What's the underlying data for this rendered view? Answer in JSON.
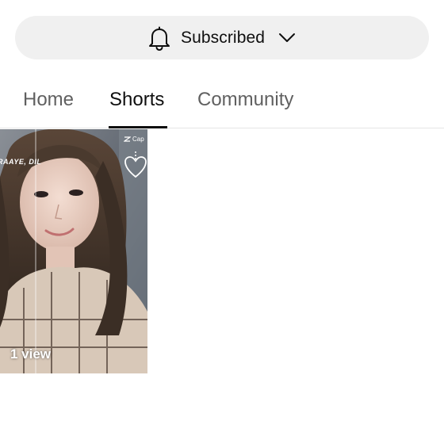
{
  "subscribe": {
    "label": "Subscribed",
    "bell_icon": "bell-icon",
    "chevron_icon": "chevron-down-icon"
  },
  "tabs": [
    {
      "label": "Home",
      "active": false
    },
    {
      "label": "Shorts",
      "active": true
    },
    {
      "label": "Community",
      "active": false
    }
  ],
  "shorts": [
    {
      "overlay_text": "RAAYE, DIL",
      "watermark": "Cap",
      "views": "1 view"
    }
  ],
  "colors": {
    "pill_bg": "#f0f0f0",
    "active_tab": "#0f0f0f",
    "inactive_tab": "#606060",
    "divider": "#e5e5e5"
  }
}
